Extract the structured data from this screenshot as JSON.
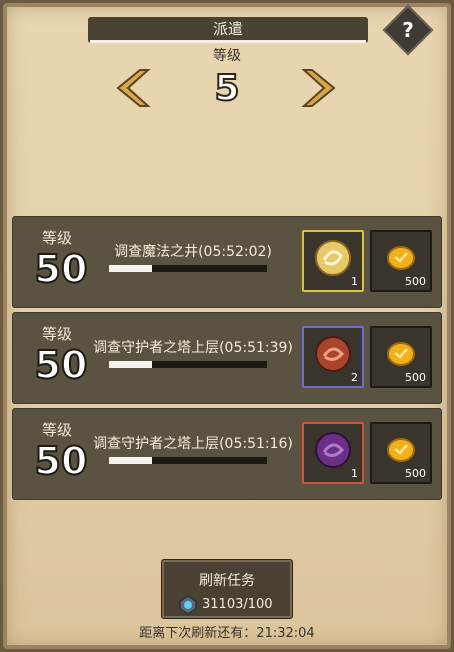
{
  "header": {
    "title": "派遣",
    "level_label": "等级",
    "level_value": "5",
    "help_symbol": "?"
  },
  "colors": {
    "panel": "#e3cfa8",
    "row_bg": "#5b5342",
    "slot_gold_border": "#d9c43c",
    "slot_blue_border": "#6f6cd6",
    "slot_red_border": "#d0563b",
    "arrow": "#d6a84a"
  },
  "missions": [
    {
      "level_label": "等级",
      "level": "50",
      "quest": "调查魔法之井(05:52:02)",
      "progress": 0.27,
      "reward_item": {
        "icon": "gold-scroll-coin-icon",
        "count": "1",
        "rarity": "gold"
      },
      "reward_gold": {
        "icon": "gold-coin-icon",
        "count": "500"
      }
    },
    {
      "level_label": "等级",
      "level": "50",
      "quest": "调查守护者之塔上层(05:51:39)",
      "progress": 0.27,
      "reward_item": {
        "icon": "red-emblem-coin-icon",
        "count": "2",
        "rarity": "blue"
      },
      "reward_gold": {
        "icon": "gold-coin-icon",
        "count": "500"
      }
    },
    {
      "level_label": "等级",
      "level": "50",
      "quest": "调查守护者之塔上层(05:51:16)",
      "progress": 0.27,
      "reward_item": {
        "icon": "purple-emblem-coin-icon",
        "count": "1",
        "rarity": "red"
      },
      "reward_gold": {
        "icon": "gold-coin-icon",
        "count": "500"
      }
    }
  ],
  "refresh": {
    "label": "刷新任务",
    "cost": "31103/100",
    "countdown": "距离下次刷新还有：21:32:04"
  }
}
